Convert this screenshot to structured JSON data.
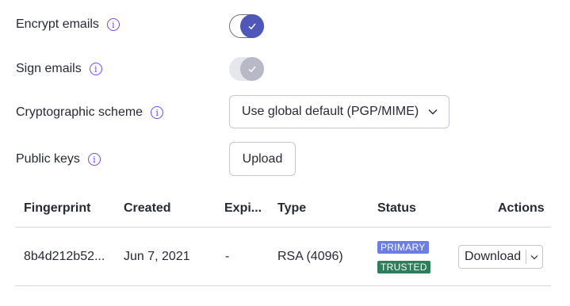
{
  "settings": {
    "encrypt": {
      "label": "Encrypt emails",
      "info_icon": "info-icon",
      "enabled": true
    },
    "sign": {
      "label": "Sign emails",
      "info_icon": "info-icon",
      "enabled": true,
      "disabled_state": true
    },
    "scheme": {
      "label": "Cryptographic scheme",
      "info_icon": "info-icon",
      "selected": "Use global default (PGP/MIME)"
    },
    "public_keys": {
      "label": "Public keys",
      "info_icon": "info-icon",
      "upload_label": "Upload"
    }
  },
  "table": {
    "headers": [
      "Fingerprint",
      "Created",
      "Expi...",
      "Type",
      "Status",
      "Actions"
    ],
    "rows": [
      {
        "fingerprint": "8b4d212b52...",
        "created": "Jun 7, 2021",
        "expires": "-",
        "type": "RSA (4096)",
        "badges": [
          "PRIMARY",
          "TRUSTED"
        ],
        "action": "Download"
      }
    ]
  },
  "colors": {
    "accent": "#6d4aff",
    "toggle_on": "#4f57b8",
    "badge_primary": "#6c7ee1",
    "badge_trusted": "#2e7d5b"
  },
  "info_glyph": "i"
}
